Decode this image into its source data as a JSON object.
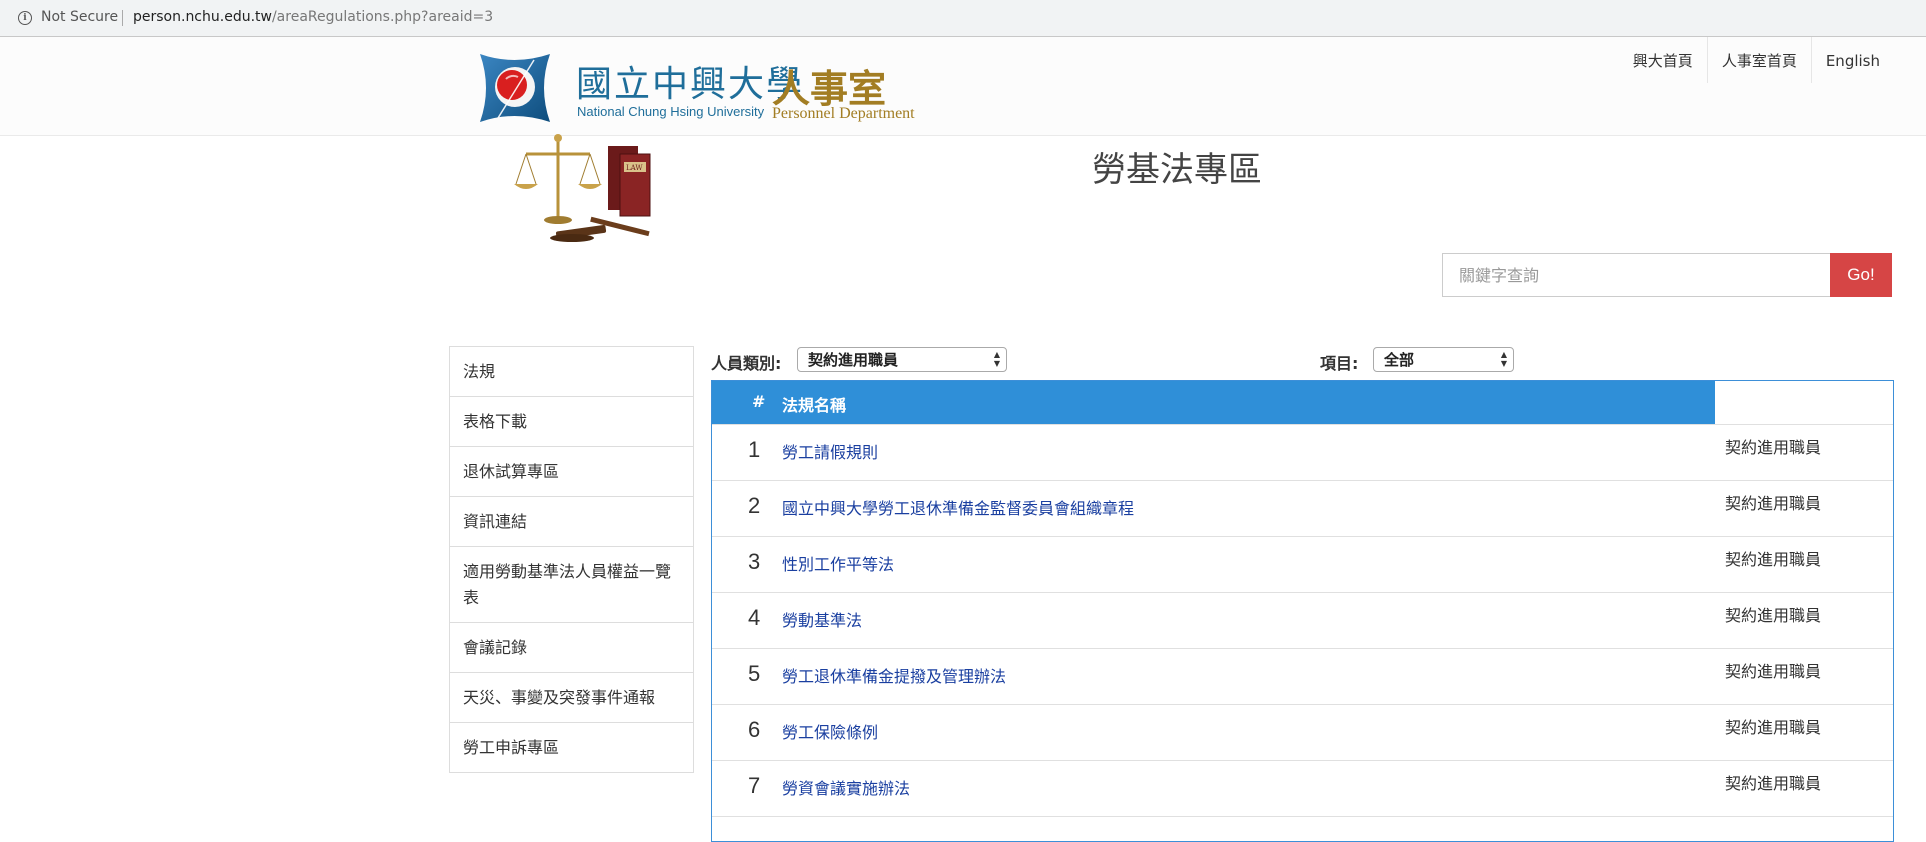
{
  "browser": {
    "security_label": "Not Secure",
    "url_host": "person.nchu.edu.tw",
    "url_path": "/areaRegulations.php?areaid=3"
  },
  "header": {
    "logo_cn": "國立中興大學",
    "logo_en": "National Chung Hsing University",
    "dept_cn": "人事室",
    "dept_en": "Personnel Department",
    "nav": [
      "興大首頁",
      "人事室首頁",
      "English"
    ]
  },
  "banner": {
    "title": "勞基法專區",
    "image_name": "law-scales-books-gavel"
  },
  "search": {
    "placeholder": "關鍵字查詢",
    "button": "Go!"
  },
  "sidebar": {
    "items": [
      "法規",
      "表格下載",
      "退休試算專區",
      "資訊連結",
      "適用勞動基準法人員權益一覽表",
      "會議記錄",
      "天災、事變及突發事件通報",
      "勞工申訴專區"
    ]
  },
  "filters": {
    "personnel_label": "人員類別:",
    "personnel_value": "契約進用職員",
    "item_label": "項目:",
    "item_value": "全部"
  },
  "table": {
    "headers": [
      "#",
      "法規名稱"
    ],
    "rows": [
      {
        "index": "1",
        "name": "勞工請假規則",
        "category": "契約進用職員"
      },
      {
        "index": "2",
        "name": "國立中興大學勞工退休準備金監督委員會組織章程",
        "category": "契約進用職員"
      },
      {
        "index": "3",
        "name": "性別工作平等法",
        "category": "契約進用職員"
      },
      {
        "index": "4",
        "name": "勞動基準法",
        "category": "契約進用職員"
      },
      {
        "index": "5",
        "name": "勞工退休準備金提撥及管理辦法",
        "category": "契約進用職員"
      },
      {
        "index": "6",
        "name": "勞工保險條例",
        "category": "契約進用職員"
      },
      {
        "index": "7",
        "name": "勞資會議實施辦法",
        "category": "契約進用職員"
      }
    ]
  },
  "colors": {
    "table_header": "#2f8fd8",
    "go_button": "#d64545",
    "link": "#1a3fa0",
    "brand_blue": "#1f6e9a",
    "brand_gold": "#a27d23"
  }
}
